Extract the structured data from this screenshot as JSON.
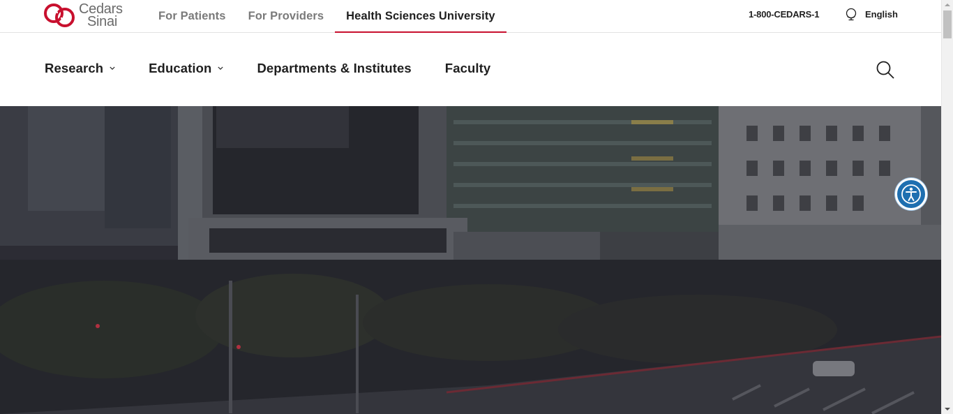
{
  "logo": {
    "line1": "Cedars",
    "line2": "Sinai",
    "brand_color": "#c8102e",
    "icon": "cedars-sinai-logo-icon"
  },
  "site_tabs": [
    {
      "label": "For Patients",
      "active": false
    },
    {
      "label": "For Providers",
      "active": false
    },
    {
      "label": "Health Sciences University",
      "active": true
    }
  ],
  "utility": {
    "phone": "1-800-CEDARS-1",
    "language": "English",
    "language_icon": "globe-icon"
  },
  "nav": {
    "items": [
      {
        "label": "Research",
        "has_dropdown": true
      },
      {
        "label": "Education",
        "has_dropdown": true
      },
      {
        "label": "Departments & Institutes",
        "has_dropdown": false
      },
      {
        "label": "Faculty",
        "has_dropdown": false
      }
    ],
    "search_icon": "search-icon"
  },
  "hero": {
    "description_icon": "hospital-building-photo"
  },
  "accessibility": {
    "icon": "accessibility-icon",
    "color": "#1e6fb0"
  },
  "colors": {
    "accent": "#c8102e",
    "text": "#1f1f1f",
    "muted": "#7a7a7a"
  }
}
